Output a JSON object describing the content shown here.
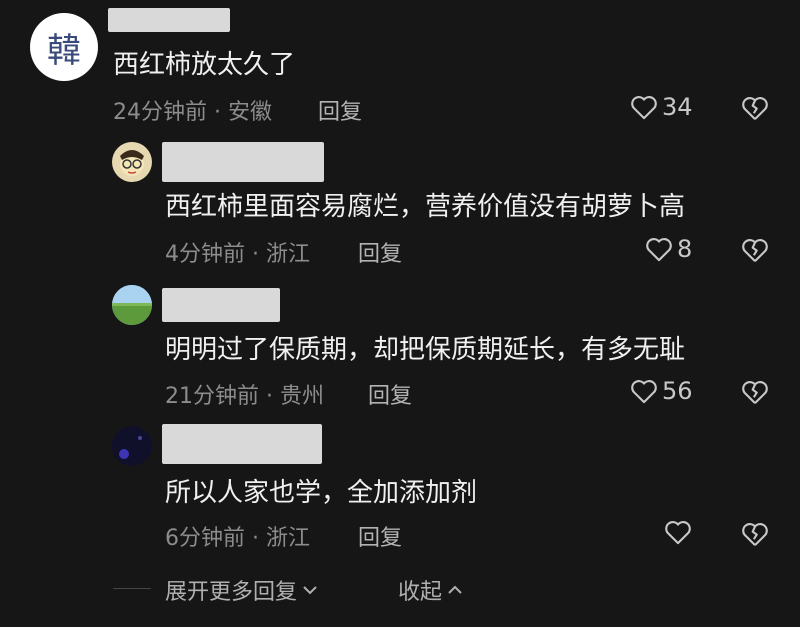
{
  "comments": [
    {
      "text": "西红柿放太久了",
      "time_location": "24分钟前 · 安徽",
      "reply_label": "回复",
      "likes": "34",
      "avatar_char": "韓"
    },
    {
      "text": "西红柿里面容易腐烂，营养价值没有胡萝卜高",
      "time_location": "4分钟前 · 浙江",
      "reply_label": "回复",
      "likes": "8"
    },
    {
      "text": "明明过了保质期，却把保质期延长，有多无耻",
      "time_location": "21分钟前 · 贵州",
      "reply_label": "回复",
      "likes": "56"
    },
    {
      "text": "所以人家也学，全加添加剂",
      "time_location": "6分钟前 · 浙江",
      "reply_label": "回复",
      "likes": ""
    }
  ],
  "footer": {
    "expand_label": "展开更多回复",
    "collapse_label": "收起"
  },
  "icons": {
    "like": "heart-outline-icon",
    "dislike": "broken-heart-icon",
    "expand": "chevron-down-icon",
    "collapse": "chevron-up-icon"
  },
  "colors": {
    "background": "#161616",
    "text": "#f0f0f0",
    "meta": "#8c8c8c"
  }
}
